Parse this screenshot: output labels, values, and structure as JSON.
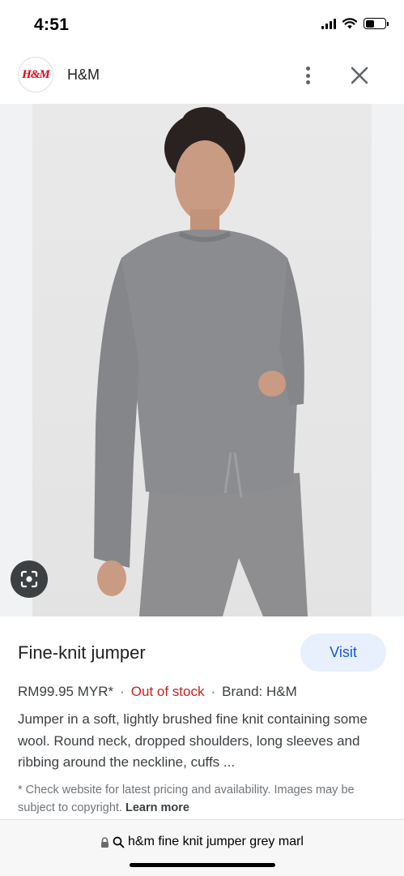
{
  "status_bar": {
    "time": "4:51",
    "icons": [
      "signal-icon",
      "wifi-icon",
      "battery-icon"
    ]
  },
  "header": {
    "logo_text": "H&M",
    "site_name": "H&M",
    "more_icon": "more-vert-icon",
    "close_icon": "close-icon"
  },
  "image": {
    "lens_icon": "lens-icon"
  },
  "result": {
    "title": "Fine-knit jumper",
    "visit_label": "Visit",
    "price": "RM99.95 MYR*",
    "separator": "·",
    "stock": "Out of stock",
    "brand": "Brand: H&M",
    "description": "Jumper in a soft, lightly brushed fine knit containing some wool. Round neck, dropped shoulders, long sleeves and ribbing around the neckline, cuffs ...",
    "disclaimer": "* Check website for latest pricing and availability. Images may be subject to copyright.",
    "learn_more": "Learn more"
  },
  "address_bar": {
    "lock_icon": "lock-icon",
    "search_icon": "search-icon",
    "query": "h&m fine knit jumper grey marl"
  },
  "colors": {
    "accent": "#1a57d6",
    "visit_bg": "#e8f0fe",
    "out_of_stock": "#c5221f",
    "brand_red": "#e50010"
  }
}
